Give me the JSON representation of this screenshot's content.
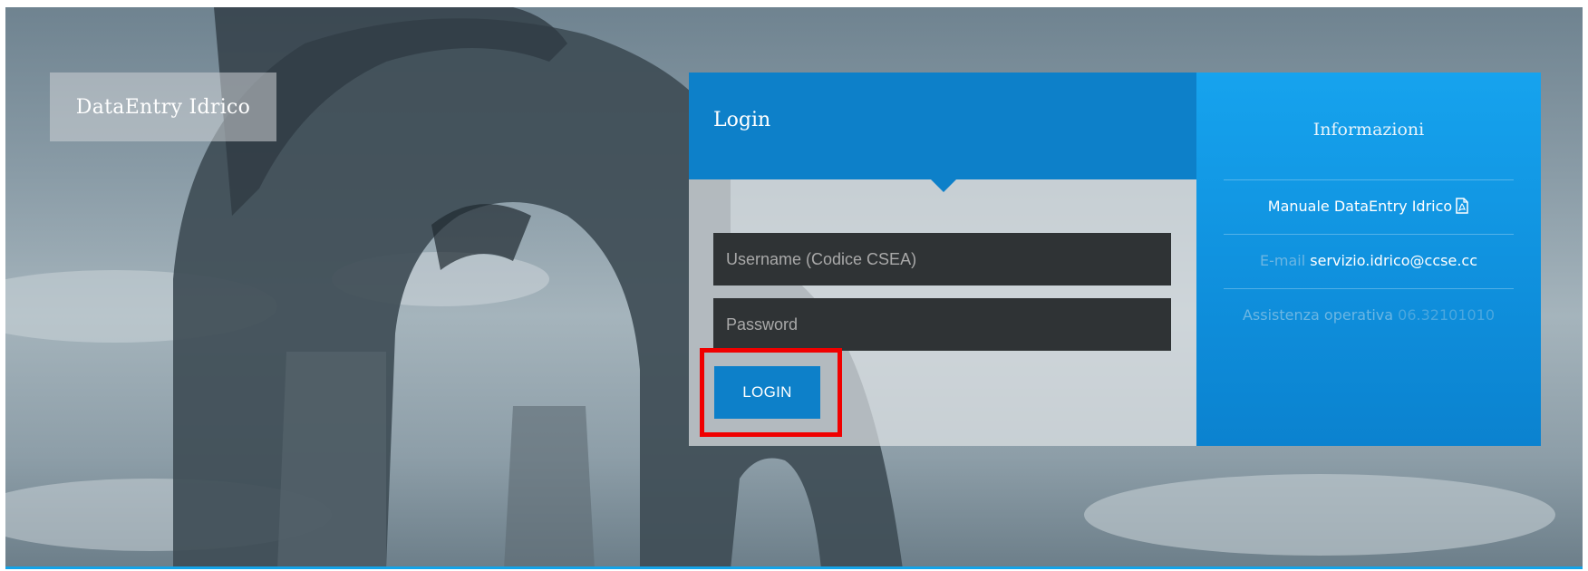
{
  "brand": {
    "title": "DataEntry Idrico"
  },
  "login": {
    "title": "Login",
    "username_placeholder": "Username (Codice CSEA)",
    "password_placeholder": "Password",
    "button_label": "LOGIN"
  },
  "info": {
    "title": "Informazioni",
    "manual_label": "Manuale DataEntry Idrico",
    "manual_icon": "pdf-file-icon",
    "email_label": "E-mail",
    "email_value": "servizio.idrico@ccse.cc",
    "support_label": "Assistenza operativa",
    "support_value": "06.32101010"
  },
  "highlight": {
    "target": "login-button",
    "color": "#f00000"
  },
  "colors": {
    "primary_blue": "#0d80c9",
    "info_blue": "#16a3ee",
    "field_dark": "#2f3335"
  }
}
